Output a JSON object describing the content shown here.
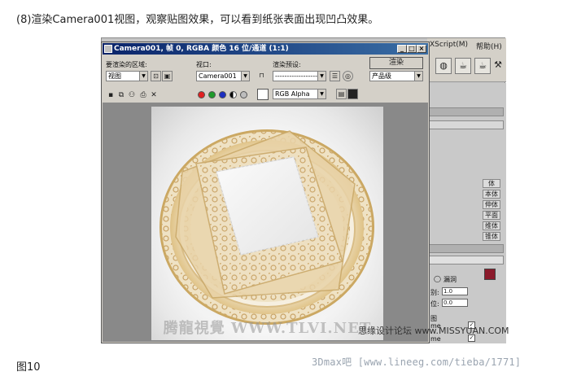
{
  "caption": "(8)渲染Camera001视图，观察贴图效果，可以看到纸张表面出现凹凸效果。",
  "figure_label": "图10",
  "footer_watermark": "3Dmax吧  [www.lineeg.com/tieba/1771]",
  "viewport_watermark": "思缘设计论坛 www.MISSYUAN.COM",
  "image_watermark": "腾龍視覺 WWW.TLVI.NET",
  "max_window": {
    "menu": [
      "XScript(M)",
      "帮助(H)"
    ],
    "toolbar_icons": [
      "star-icon",
      "help-icon",
      "window-min-icon",
      "window-max-icon",
      "window-close-icon"
    ],
    "command_panel": {
      "items": [
        "体",
        "本体",
        "伸体",
        "平面",
        "维体",
        "锥体"
      ],
      "radio_label": "漏洞",
      "spinner1_label": "别:",
      "spinner1_value": "1.0",
      "spinner2_label": "位:",
      "spinner2_value": "0.0",
      "map_label": "图",
      "map_row1": "me",
      "map_row2": "me"
    },
    "accent_swatch": "#8b1a2b"
  },
  "render_window": {
    "title": "Camera001, 帧 0, RGBA 颜色 16 位/通道 (1:1)",
    "area_label": "要渲染的区域:",
    "area_value": "视图",
    "viewport_label": "视口:",
    "viewport_value": "Camera001",
    "preset_label": "渲染预设:",
    "preset_value": "--------------------",
    "render_button": "渲染",
    "product_value": "产品级",
    "channel_value": "RGB Alpha",
    "close_icon": "close-x-icon"
  }
}
